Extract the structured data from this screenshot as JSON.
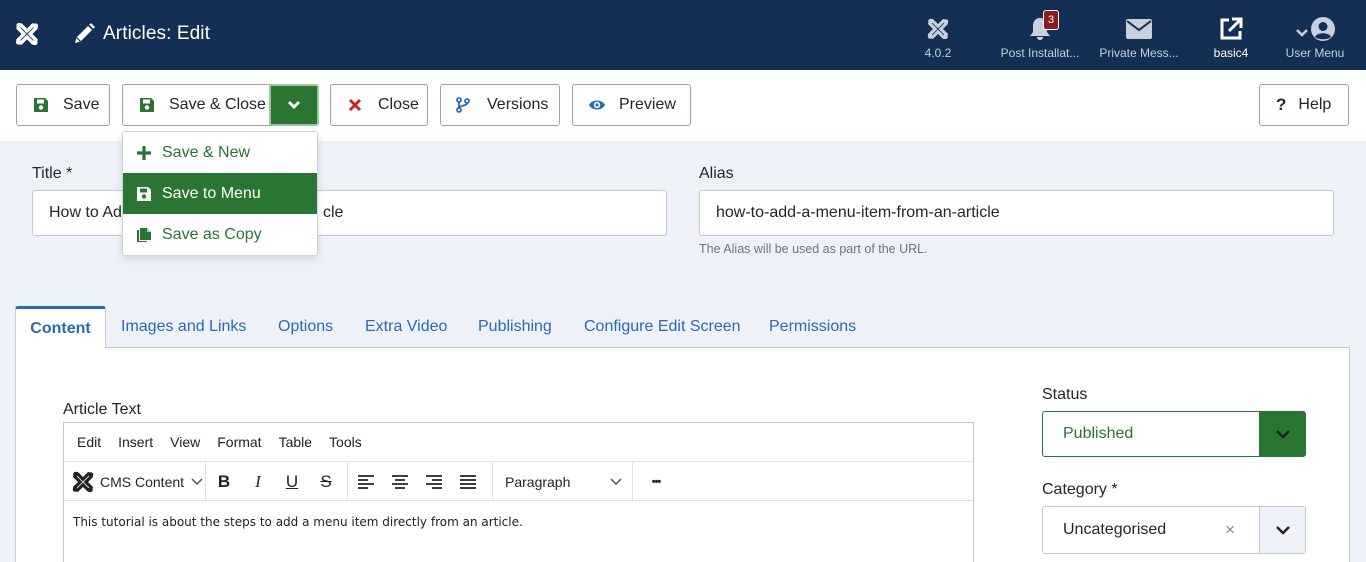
{
  "header": {
    "page_title": "Articles: Edit",
    "version": "4.0.2",
    "post_install_label": "Post Installat...",
    "post_install_badge": "3",
    "private_msg_label": "Private Mess...",
    "site_label": "basic4",
    "user_menu_label": "User Menu",
    "icons": [
      "joomla-logo-icon",
      "pencil-icon",
      "joomla-icon",
      "bell-icon",
      "envelope-icon",
      "external-link-icon",
      "user-icon"
    ]
  },
  "toolbar": {
    "save": "Save",
    "save_close": "Save & Close",
    "close": "Close",
    "versions": "Versions",
    "preview": "Preview",
    "help": "Help"
  },
  "dropdown": {
    "items": [
      {
        "label": "Save & New",
        "icon": "plus-icon"
      },
      {
        "label": "Save to Menu",
        "icon": "save-icon",
        "active": true
      },
      {
        "label": "Save as Copy",
        "icon": "copy-icon"
      }
    ]
  },
  "form": {
    "title_label": "Title *",
    "title_value_left": "How to Ad",
    "title_value_right": "cle",
    "alias_label": "Alias",
    "alias_value": "how-to-add-a-menu-item-from-an-article",
    "alias_help": "The Alias will be used as part of the URL."
  },
  "tabs": [
    "Content",
    "Images and Links",
    "Options",
    "Extra Video",
    "Publishing",
    "Configure Edit Screen",
    "Permissions"
  ],
  "editor": {
    "label": "Article Text",
    "menus": [
      "Edit",
      "Insert",
      "View",
      "Format",
      "Table",
      "Tools"
    ],
    "cms_content": "CMS Content",
    "block_format": "Paragraph",
    "more": "•••",
    "text": "This tutorial is about the steps to add a menu item directly from an article."
  },
  "sidebar": {
    "status_label": "Status",
    "status_value": "Published",
    "category_label": "Category *",
    "category_value": "Uncategorised",
    "clear": "×"
  },
  "colors": {
    "header_bg": "#132f53",
    "green": "#2a7531",
    "blue": "#2a69b8",
    "red": "#c52827"
  }
}
